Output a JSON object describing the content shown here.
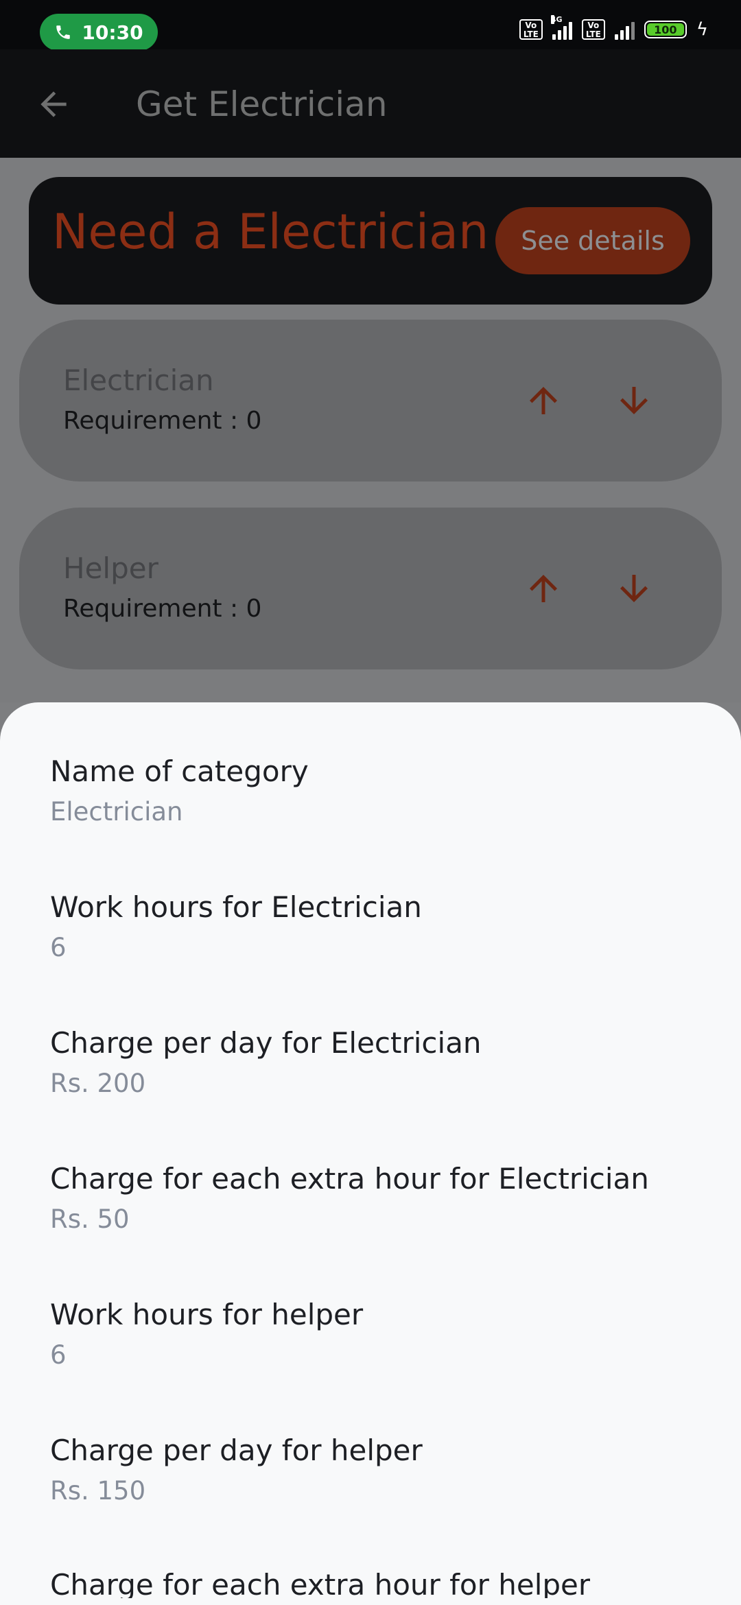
{
  "status_bar": {
    "time": "10:30",
    "network_type": "4G",
    "volte_label_top": "Vo",
    "volte_label_bottom": "LTE",
    "battery_level": "100",
    "call_icon": "phone-icon",
    "charging_icon": "bolt-icon"
  },
  "app_bar": {
    "title": "Get Electrician",
    "back_icon": "arrow-left-icon"
  },
  "banner": {
    "title": "Need a Electrician ?",
    "button_label": "See details"
  },
  "cards": [
    {
      "title": "Electrician",
      "requirement": "Requirement : 0"
    },
    {
      "title": "Helper",
      "requirement": "Requirement : 0"
    }
  ],
  "sheet": {
    "fields": [
      {
        "label": "Name of category",
        "value": "Electrician"
      },
      {
        "label": "Work hours for Electrician",
        "value": "6"
      },
      {
        "label": "Charge per day for Electrician",
        "value": "Rs. 200"
      },
      {
        "label": "Charge for each extra hour for Electrician",
        "value": "Rs. 50"
      },
      {
        "label": "Work hours for helper",
        "value": "6"
      },
      {
        "label": "Charge per day for helper",
        "value": "Rs. 150"
      }
    ],
    "partial_label": "Charge for each extra hour for helper"
  },
  "colors": {
    "accent": "#8c2e14",
    "button": "#6f2611",
    "scrim": "#7b7c7e",
    "sheet": "#f8f9fa"
  }
}
